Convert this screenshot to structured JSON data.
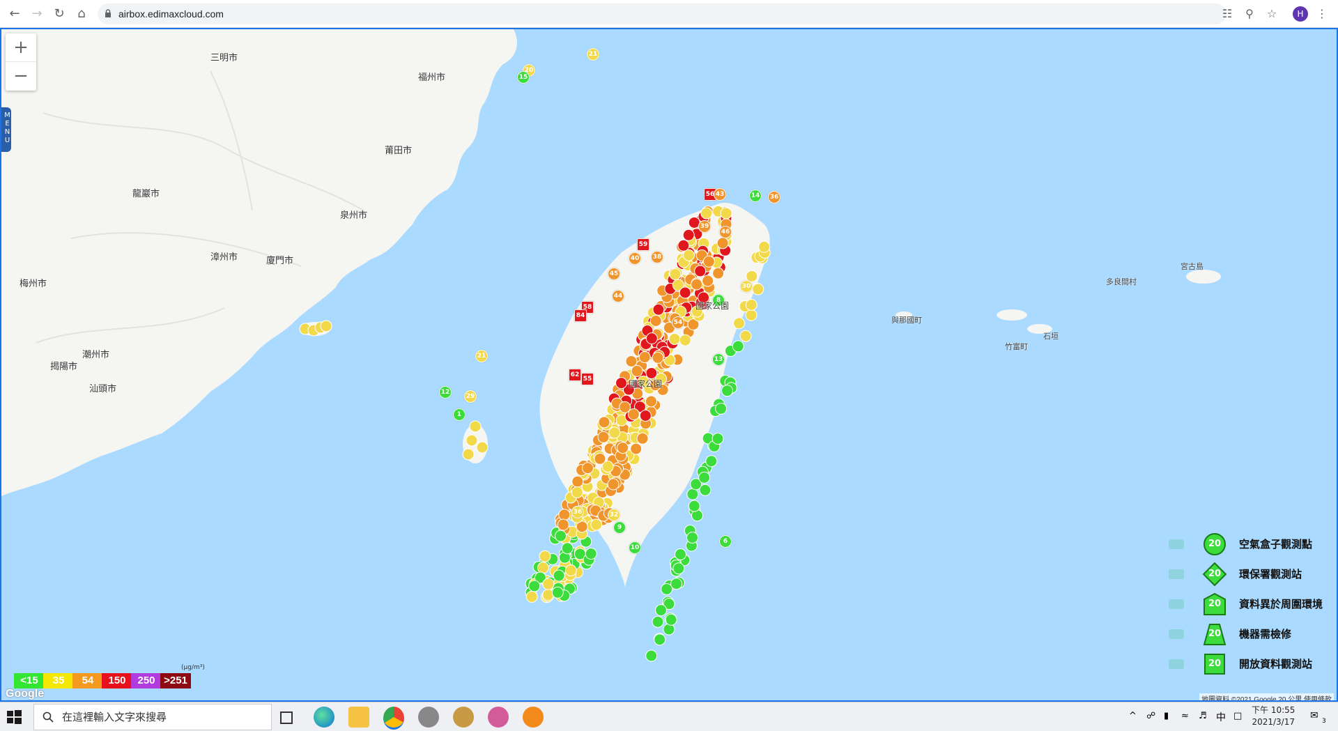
{
  "browser": {
    "url": "airbox.edimaxcloud.com",
    "nav_back_icon": "arrow-left-icon",
    "nav_forward_icon": "arrow-right-icon",
    "reload_icon": "reload-icon",
    "home_icon": "home-icon",
    "avatar_letter": "H"
  },
  "map": {
    "zoom_in_label": "+",
    "zoom_out_label": "−",
    "menu_label": "MENU",
    "cities": [
      {
        "name": "三明市"
      },
      {
        "name": "福州市"
      },
      {
        "name": "莆田市"
      },
      {
        "name": "龍巖市"
      },
      {
        "name": "泉州市"
      },
      {
        "name": "漳州市"
      },
      {
        "name": "廈門市"
      },
      {
        "name": "梅州市"
      },
      {
        "name": "潮州市"
      },
      {
        "name": "揭陽市"
      },
      {
        "name": "汕頭市"
      }
    ],
    "islands": [
      {
        "name": "宮古島"
      },
      {
        "name": "多良間村"
      },
      {
        "name": "與那國町"
      },
      {
        "name": "石垣"
      },
      {
        "name": "竹富町"
      }
    ],
    "park_labels": [
      "國家公園",
      "國家公園"
    ],
    "google_logo": "Google",
    "attribution": "地圖資料 ©2021 Google   20 公里        使用條款",
    "colors": {
      "green": "#3bdc3b",
      "yellow": "#f2d94a",
      "orange": "#f0942c",
      "red": "#e0181e",
      "purple": "#a83bd6",
      "maroon": "#8b0a14",
      "sea": "#aadaff",
      "land": "#f5f5f2"
    }
  },
  "scale": {
    "unit": "(μg/m³)",
    "items": [
      {
        "label": "<15",
        "color": "#33e633"
      },
      {
        "label": "35",
        "color": "#f5e800"
      },
      {
        "label": "54",
        "color": "#f59a1e"
      },
      {
        "label": "150",
        "color": "#e8101a"
      },
      {
        "label": "250",
        "color": "#b23be0"
      },
      {
        "label": ">251",
        "color": "#8e0a12"
      }
    ]
  },
  "legend": {
    "items": [
      {
        "label": "空氣盒子觀測點",
        "value": "20",
        "icon": "airbox-icon",
        "shape": "circle"
      },
      {
        "label": "環保署觀測站",
        "value": "20",
        "icon": "government-building-icon",
        "shape": "diamond"
      },
      {
        "label": "資料異於周圍環境",
        "value": "20",
        "icon": "house-icon",
        "shape": "pentagon"
      },
      {
        "label": "機器需檢修",
        "value": "20",
        "icon": "cone-icon",
        "shape": "trapezoid"
      },
      {
        "label": "開放資料觀測站",
        "value": "20",
        "icon": "open-data-icon",
        "shape": "square"
      }
    ]
  },
  "markers": [
    {
      "v": "21",
      "c": "yellow"
    },
    {
      "v": "20",
      "c": "yellow"
    },
    {
      "v": "15",
      "c": "green"
    },
    {
      "v": "56",
      "c": "red"
    },
    {
      "v": "43",
      "c": "orange"
    },
    {
      "v": "14",
      "c": "green"
    },
    {
      "v": "36",
      "c": "orange"
    },
    {
      "v": "59",
      "c": "red"
    },
    {
      "v": "39",
      "c": "orange"
    },
    {
      "v": "46",
      "c": "orange"
    },
    {
      "v": "45",
      "c": "orange"
    },
    {
      "v": "58",
      "c": "red"
    },
    {
      "v": "84",
      "c": "red"
    },
    {
      "v": "44",
      "c": "orange"
    },
    {
      "v": "54",
      "c": "orange"
    },
    {
      "v": "62",
      "c": "red"
    },
    {
      "v": "55",
      "c": "red"
    },
    {
      "v": "30",
      "c": "yellow"
    },
    {
      "v": "8",
      "c": "green"
    },
    {
      "v": "12",
      "c": "green"
    },
    {
      "v": "1",
      "c": "green"
    },
    {
      "v": "29",
      "c": "yellow"
    },
    {
      "v": "21",
      "c": "yellow"
    },
    {
      "v": "6",
      "c": "green"
    },
    {
      "v": "9",
      "c": "green"
    },
    {
      "v": "10",
      "c": "green"
    },
    {
      "v": "36",
      "c": "yellow"
    },
    {
      "v": "32",
      "c": "yellow"
    },
    {
      "v": "40",
      "c": "orange"
    },
    {
      "v": "38",
      "c": "orange"
    },
    {
      "v": "13",
      "c": "green"
    }
  ],
  "taskbar": {
    "search_placeholder": "在這裡輸入文字來搜尋",
    "ime": "中",
    "time": "下午 10:55",
    "date": "2021/3/17",
    "notif_count": "3"
  }
}
